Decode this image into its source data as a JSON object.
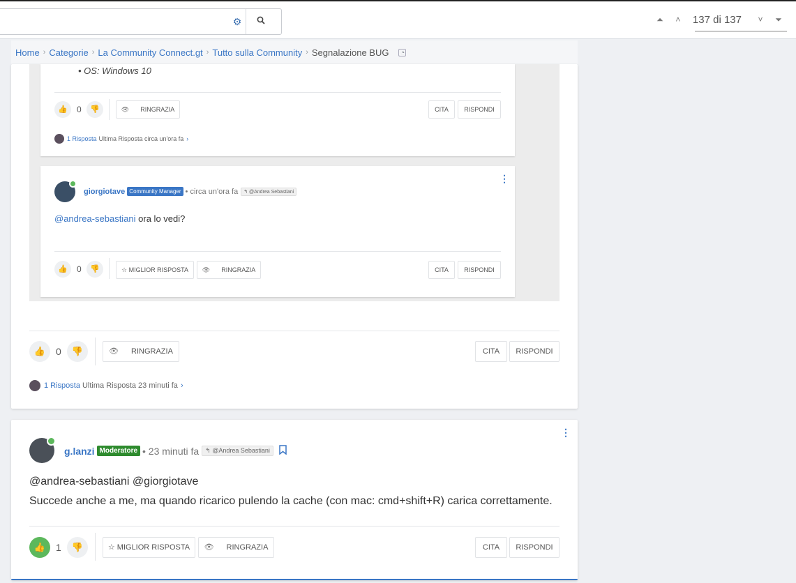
{
  "search": {
    "value": "",
    "placeholder": "",
    "options_icon": "gears-icon",
    "search_icon": "search-icon"
  },
  "pager": {
    "count": "137 di 137"
  },
  "breadcrumb": {
    "items": [
      "Home",
      "Categorie",
      "La Community Connect.gt",
      "Tutto sulla Community"
    ],
    "current": "Segnalazione BUG"
  },
  "quoted": {
    "bullet": "OS: Windows 10",
    "q1": {
      "likes": "0",
      "ringrazia": "RINGRAZIA",
      "cita": "CITA",
      "rispondi": "RISPONDI",
      "replies_link": "1 Risposta",
      "replies_last": "Ultima Risposta circa un'ora fa"
    },
    "q2": {
      "author": "giorgiotave",
      "badge": "Community Manager",
      "time": "• circa un'ora fa",
      "reply_to": "@Andrea Sebastiani",
      "mention": "@andrea-sebastiani",
      "text": " ora lo vedi?",
      "likes": "0",
      "best": "☆ MIGLIOR RISPOSTA",
      "ringrazia": "RINGRAZIA",
      "cita": "CITA",
      "rispondi": "RISPONDI"
    }
  },
  "post1": {
    "likes": "0",
    "ringrazia": "RINGRAZIA",
    "cita": "CITA",
    "rispondi": "RISPONDI",
    "replies_link": "1 Risposta",
    "replies_last": "Ultima Risposta 23 minuti fa"
  },
  "post2": {
    "author": "g.lanzi",
    "badge": "Moderatore",
    "time": "• 23 minuti fa",
    "reply_to": "@Andrea Sebastiani",
    "mentions": "@andrea-sebastiani @giorgiotave",
    "text": "Succede anche a me, ma quando ricarico pulendo la cache (con mac: cmd+shift+R) carica correttamente.",
    "likes": "1",
    "best": "☆ MIGLIOR RISPOSTA",
    "ringrazia": "RINGRAZIA",
    "cita": "CITA",
    "rispondi": "RISPONDI"
  },
  "colors": {
    "link": "#3a76c5",
    "online": "#5cb85c",
    "moderator": "#2e8b2e",
    "manager": "#3a76c5"
  }
}
